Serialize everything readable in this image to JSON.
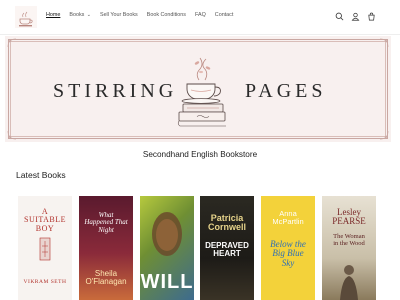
{
  "header": {
    "nav": [
      {
        "label": "Home",
        "active": true
      },
      {
        "label": "Books",
        "has_dropdown": true
      },
      {
        "label": "Sell Your Books"
      },
      {
        "label": "Book Conditions"
      },
      {
        "label": "FAQ"
      },
      {
        "label": "Contact"
      }
    ],
    "icons": [
      "search-icon",
      "account-icon",
      "cart-icon"
    ]
  },
  "banner": {
    "word_left": "STIRRING",
    "word_right": "PAGES"
  },
  "tagline": "Secondhand English Bookstore",
  "section_title": "Latest Books",
  "books": [
    {
      "title": "A SUITABLE BOY",
      "author": "VIKRAM SETH",
      "bg": "#f7f3f0",
      "fg": "#b1312b"
    },
    {
      "title": "What Happened That Night",
      "author": "Sheila O'Flanagan",
      "bg": "#7b2034",
      "fg": "#ffffff"
    },
    {
      "title": "WILL",
      "author": "",
      "bg": "#8aa23a",
      "fg": "#ffffff"
    },
    {
      "title": "DEPRAVED HEART",
      "author": "Patricia Cornwell",
      "bg": "#1d1b17",
      "fg": "#e6d38a"
    },
    {
      "title": "Below the Big Blue Sky",
      "author": "Anna McPartlin",
      "bg": "#f3d23a",
      "fg": "#2e6fb5"
    },
    {
      "title": "The Woman in the Wood",
      "author": "Lesley PEARSE",
      "bg": "#d9d2c2",
      "fg": "#7b2a2a"
    }
  ],
  "colors": {
    "banner_bg": "#f8f0ef",
    "banner_border": "#c9a7a2"
  }
}
